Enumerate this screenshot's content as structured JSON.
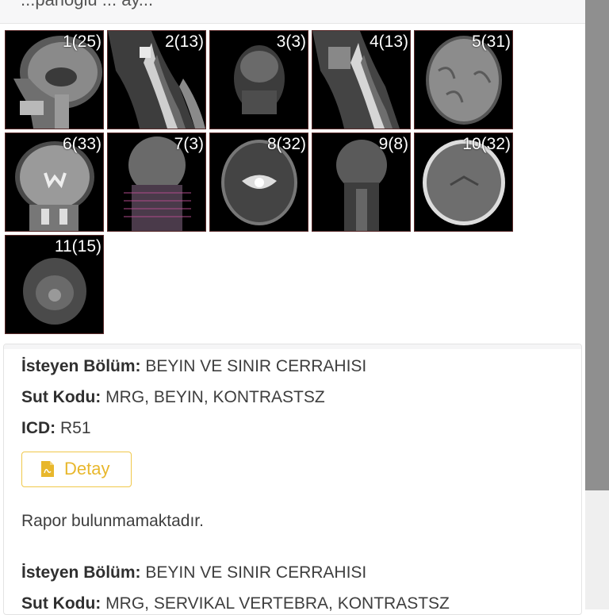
{
  "header": {
    "title": "...panoglu ... ay..."
  },
  "series": [
    {
      "label": "1(25)",
      "view": "sagittal-head"
    },
    {
      "label": "2(13)",
      "view": "sagittal-neck"
    },
    {
      "label": "3(3)",
      "view": "coronal-dark"
    },
    {
      "label": "4(13)",
      "view": "sagittal-neck"
    },
    {
      "label": "5(31)",
      "view": "axial-flair"
    },
    {
      "label": "6(33)",
      "view": "coronal-t2"
    },
    {
      "label": "7(3)",
      "view": "coronal-localizer"
    },
    {
      "label": "8(32)",
      "view": "axial-t2"
    },
    {
      "label": "9(8)",
      "view": "coronal-dark"
    },
    {
      "label": "10(32)",
      "view": "axial-t1"
    },
    {
      "label": "11(15)",
      "view": "axial-neck"
    }
  ],
  "report": {
    "department_label": "İsteyen Bölüm:",
    "department_value": "BEYIN VE SINIR CERRAHISI",
    "sut_label": "Sut Kodu:",
    "sut_value": "MRG, BEYIN, KONTRASTSZ",
    "icd_label": "ICD:",
    "icd_value": "R51",
    "detail_button": "Detay",
    "detail_icon": "pdf-file-icon",
    "no_report_text": "Rapor bulunmamaktadır."
  },
  "report2": {
    "department_label": "İsteyen Bölüm:",
    "department_value": "BEYIN VE SINIR CERRAHISI",
    "sut_label": "Sut Kodu:",
    "sut_value": "MRG, SERVIKAL VERTEBRA, KONTRASTSZ"
  },
  "colors": {
    "accent": "#f0c84a",
    "accent_text": "#e8b72c",
    "scroll_thumb": "#8f8f8f"
  }
}
